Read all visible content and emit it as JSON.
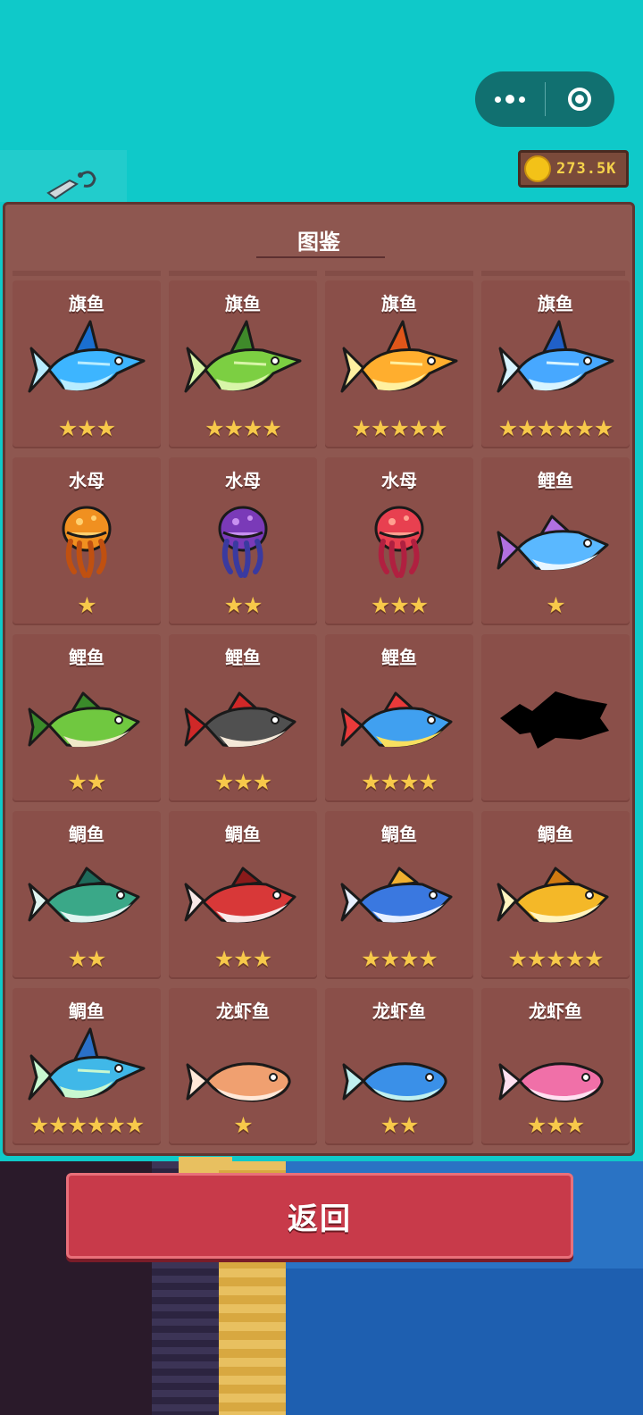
{
  "currency": {
    "coins": "273.5K"
  },
  "panel": {
    "title": "图鉴"
  },
  "back_button": {
    "label": "返回"
  },
  "cells": [
    {
      "name": "旗鱼",
      "stars": 3,
      "shape": "marlin",
      "colors": [
        "#3db5ff",
        "#b8ecff",
        "#1a6fd0"
      ]
    },
    {
      "name": "旗鱼",
      "stars": 4,
      "shape": "marlin",
      "colors": [
        "#7ccf42",
        "#d8f5a8",
        "#3f8a2a"
      ]
    },
    {
      "name": "旗鱼",
      "stars": 5,
      "shape": "marlin",
      "colors": [
        "#ffae2e",
        "#fff0a0",
        "#e0561a"
      ]
    },
    {
      "name": "旗鱼",
      "stars": 6,
      "shape": "marlin",
      "colors": [
        "#47a8ff",
        "#d8f4ff",
        "#2060c8"
      ]
    },
    {
      "name": "水母",
      "stars": 1,
      "shape": "jelly",
      "colors": [
        "#f09020",
        "#ffd070",
        "#c05010"
      ]
    },
    {
      "name": "水母",
      "stars": 2,
      "shape": "jelly",
      "colors": [
        "#7a3ab8",
        "#c890f0",
        "#3a3aa0"
      ]
    },
    {
      "name": "水母",
      "stars": 3,
      "shape": "jelly",
      "colors": [
        "#e84050",
        "#ffa090",
        "#b02040"
      ]
    },
    {
      "name": "鲤鱼",
      "stars": 1,
      "shape": "carp",
      "colors": [
        "#5ab8ff",
        "#e8f6ff",
        "#b070e0"
      ]
    },
    {
      "name": "鲤鱼",
      "stars": 2,
      "shape": "carp",
      "colors": [
        "#70c840",
        "#f0e8c8",
        "#3a8a2a"
      ]
    },
    {
      "name": "鲤鱼",
      "stars": 3,
      "shape": "carp",
      "colors": [
        "#505050",
        "#f4e8d8",
        "#d02828"
      ]
    },
    {
      "name": "鲤鱼",
      "stars": 4,
      "shape": "carp",
      "colors": [
        "#40a0f0",
        "#f8e060",
        "#e83a3a"
      ]
    },
    {
      "name": "",
      "stars": 0,
      "shape": "silhouette",
      "colors": [
        "#000000",
        "#000000",
        "#000000"
      ]
    },
    {
      "name": "鲷鱼",
      "stars": 2,
      "shape": "bream",
      "colors": [
        "#3aa888",
        "#e0f4f0",
        "#1e6a5a"
      ]
    },
    {
      "name": "鲷鱼",
      "stars": 3,
      "shape": "bream",
      "colors": [
        "#d83838",
        "#f8e8e8",
        "#8a1a1a"
      ]
    },
    {
      "name": "鲷鱼",
      "stars": 4,
      "shape": "bream",
      "colors": [
        "#3a78e0",
        "#e8f0ff",
        "#f0b030"
      ]
    },
    {
      "name": "鲷鱼",
      "stars": 5,
      "shape": "bream",
      "colors": [
        "#f4b828",
        "#fff4c0",
        "#d07a10"
      ]
    },
    {
      "name": "鲷鱼",
      "stars": 6,
      "shape": "marlin",
      "colors": [
        "#40b8e8",
        "#c8f8d0",
        "#2a70c8"
      ]
    },
    {
      "name": "龙虾鱼",
      "stars": 1,
      "shape": "small",
      "colors": [
        "#f0a070",
        "#ffe8d8",
        "#b06040"
      ]
    },
    {
      "name": "龙虾鱼",
      "stars": 2,
      "shape": "small",
      "colors": [
        "#3a90e8",
        "#c0f0f0",
        "#2060b0"
      ]
    },
    {
      "name": "龙虾鱼",
      "stars": 3,
      "shape": "small",
      "colors": [
        "#f070a8",
        "#ffe0f0",
        "#b04080"
      ]
    }
  ]
}
